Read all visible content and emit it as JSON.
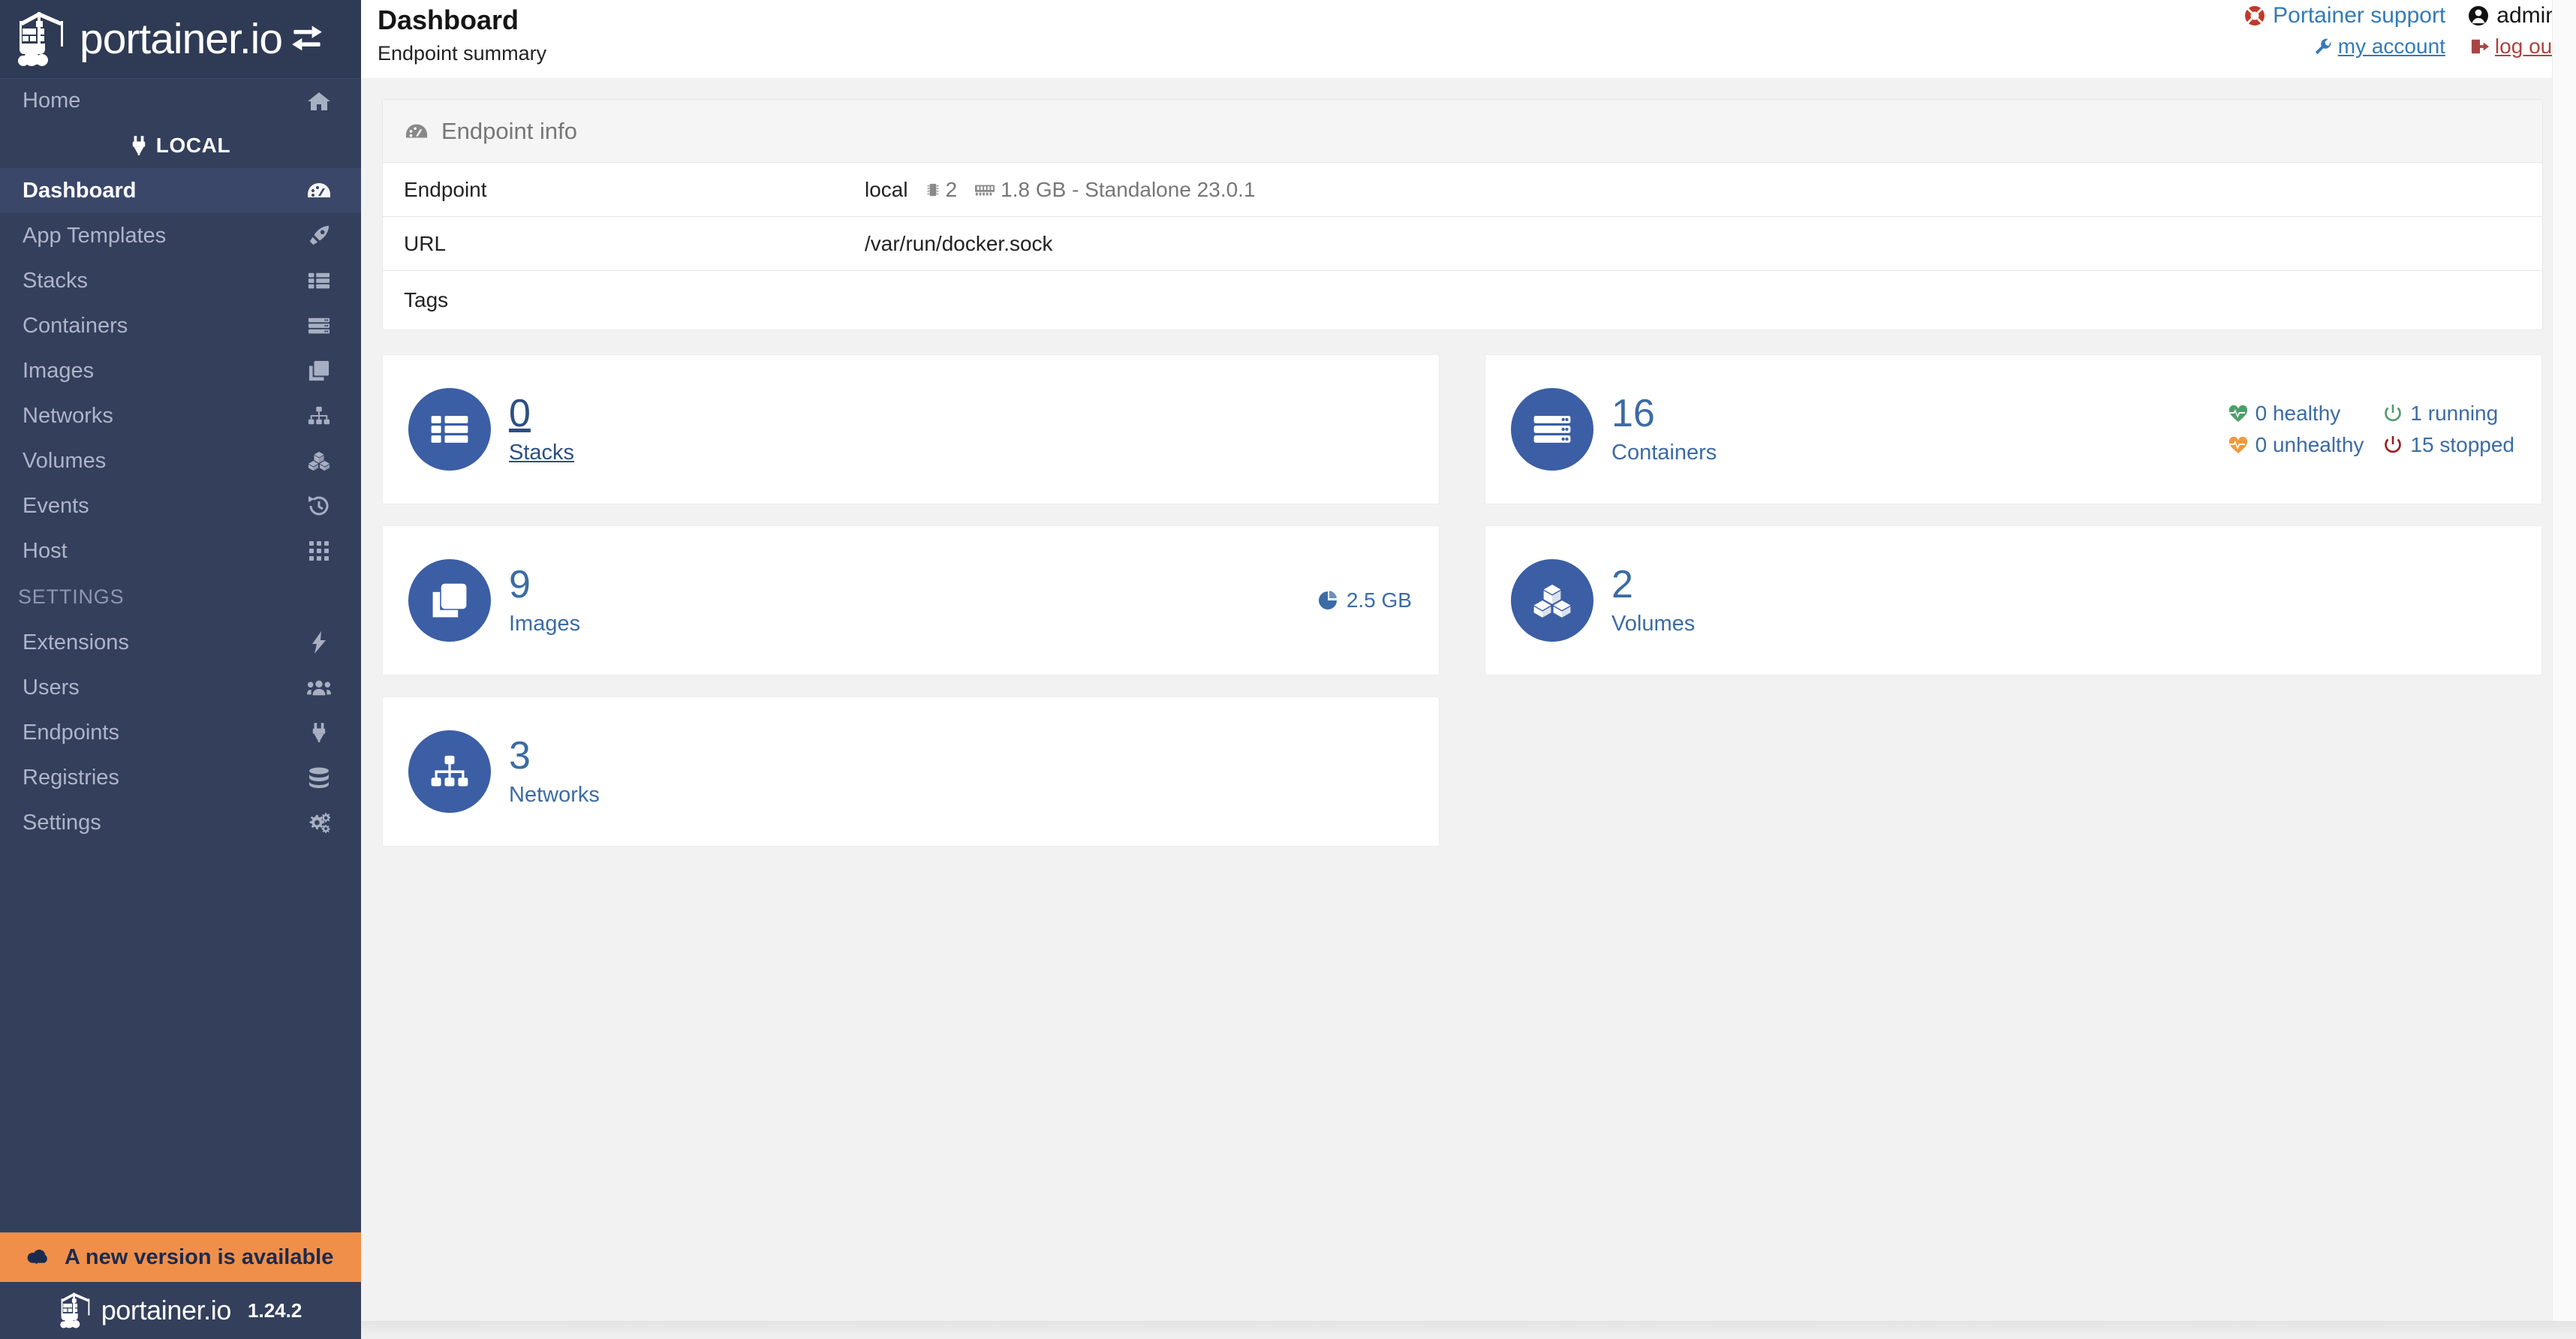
{
  "brand": {
    "name": "portainer.io",
    "version": "1.24.2",
    "update_banner": "A new version is available"
  },
  "sidebar": {
    "home": {
      "label": "Home",
      "icon": "home-icon"
    },
    "local_section": {
      "label": "LOCAL",
      "icon": "plug-icon"
    },
    "items": [
      {
        "label": "Dashboard",
        "icon": "dashboard-icon",
        "active": true
      },
      {
        "label": "App Templates",
        "icon": "rocket-icon",
        "active": false
      },
      {
        "label": "Stacks",
        "icon": "list-icon",
        "active": false
      },
      {
        "label": "Containers",
        "icon": "server-icon",
        "active": false
      },
      {
        "label": "Images",
        "icon": "clone-icon",
        "active": false
      },
      {
        "label": "Networks",
        "icon": "sitemap-icon",
        "active": false
      },
      {
        "label": "Volumes",
        "icon": "cubes-icon",
        "active": false
      },
      {
        "label": "Events",
        "icon": "history-icon",
        "active": false
      },
      {
        "label": "Host",
        "icon": "th-icon",
        "active": false
      }
    ],
    "settings_section": "SETTINGS",
    "settings_items": [
      {
        "label": "Extensions",
        "icon": "bolt-icon"
      },
      {
        "label": "Users",
        "icon": "users-icon"
      },
      {
        "label": "Endpoints",
        "icon": "plug-icon"
      },
      {
        "label": "Registries",
        "icon": "database-icon"
      },
      {
        "label": "Settings",
        "icon": "cogs-icon"
      }
    ]
  },
  "header": {
    "title": "Dashboard",
    "subtitle": "Endpoint summary",
    "support_label": "Portainer support",
    "user_name": "admin",
    "my_account_label": "my account",
    "log_out_label": "log out"
  },
  "endpoint_info": {
    "panel_title": "Endpoint info",
    "rows": [
      {
        "key": "Endpoint",
        "value": "local",
        "cpu": "2",
        "memory": "1.8 GB - Standalone 23.0.1"
      },
      {
        "key": "URL",
        "value": "/var/run/docker.sock"
      },
      {
        "key": "Tags",
        "value": ""
      }
    ]
  },
  "cards": {
    "stacks": {
      "count": "0",
      "label": "Stacks",
      "icon": "list-icon"
    },
    "containers": {
      "count": "16",
      "label": "Containers",
      "icon": "server-icon",
      "healthy": "0 healthy",
      "unhealthy": "0 unhealthy",
      "running": "1 running",
      "stopped": "15 stopped"
    },
    "images": {
      "count": "9",
      "label": "Images",
      "icon": "clone-icon",
      "size": "2.5 GB"
    },
    "volumes": {
      "count": "2",
      "label": "Volumes",
      "icon": "cubes-icon"
    },
    "networks": {
      "count": "3",
      "label": "Networks",
      "icon": "sitemap-icon"
    }
  },
  "colors": {
    "sidebar_bg": "#333f5b",
    "accent_blue": "#3b5ea5",
    "link_blue": "#337ab7",
    "warning_orange": "#ef8f4a",
    "danger_red": "#a94442",
    "healthy_green": "#5cb85c",
    "unhealthy_amber": "#ef9a3d"
  }
}
